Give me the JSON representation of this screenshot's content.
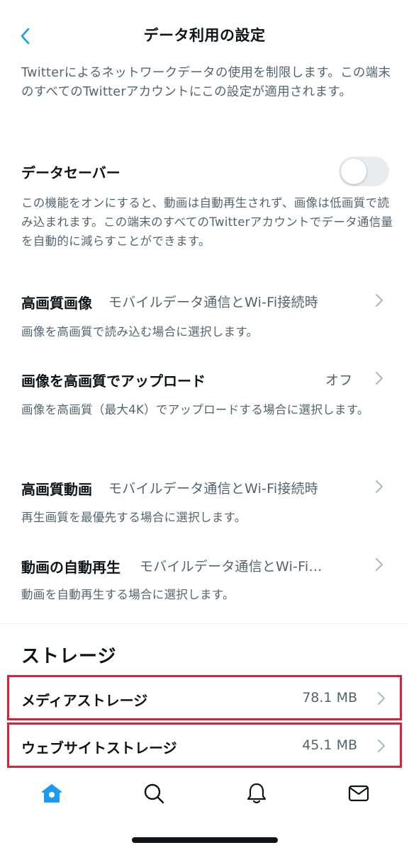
{
  "header": {
    "title": "データ利用の設定"
  },
  "intro": "Twitterによるネットワークデータの使用を制限します。この端末のすべてのTwitterアカウントにこの設定が適用されます。",
  "data_saver": {
    "label": "データセーバー",
    "enabled": false,
    "description": "この機能をオンにすると、動画は自動再生されず、画像は低画質で読み込まれます。この端末のすべてのTwitterアカウントでデータ通信量を自動的に減らすことができます。"
  },
  "settings": [
    {
      "title": "高画質画像",
      "value": "モバイルデータ通信とWi-Fi接続時",
      "description": "画像を高画質で読み込む場合に選択します。"
    },
    {
      "title": "画像を高画質でアップロード",
      "value": "オフ",
      "description": "画像を高画質（最大4K）でアップロードする場合に選択します。"
    },
    {
      "title": "高画質動画",
      "value": "モバイルデータ通信とWi-Fi接続時",
      "description": "再生画質を最優先する場合に選択します。"
    },
    {
      "title": "動画の自動再生",
      "value": "モバイルデータ通信とWi-Fi…",
      "description": "動画を自動再生する場合に選択します。"
    }
  ],
  "storage": {
    "heading": "ストレージ",
    "items": [
      {
        "title": "メディアストレージ",
        "value": "78.1 MB"
      },
      {
        "title": "ウェブサイトストレージ",
        "value": "45.1 MB"
      }
    ]
  },
  "colors": {
    "accent": "#1d9bf0",
    "text_primary": "#0f1419",
    "text_secondary": "#536471",
    "highlight_border": "#d0253a"
  },
  "tabbar": [
    "home-icon",
    "search-icon",
    "notifications-icon",
    "messages-icon"
  ]
}
